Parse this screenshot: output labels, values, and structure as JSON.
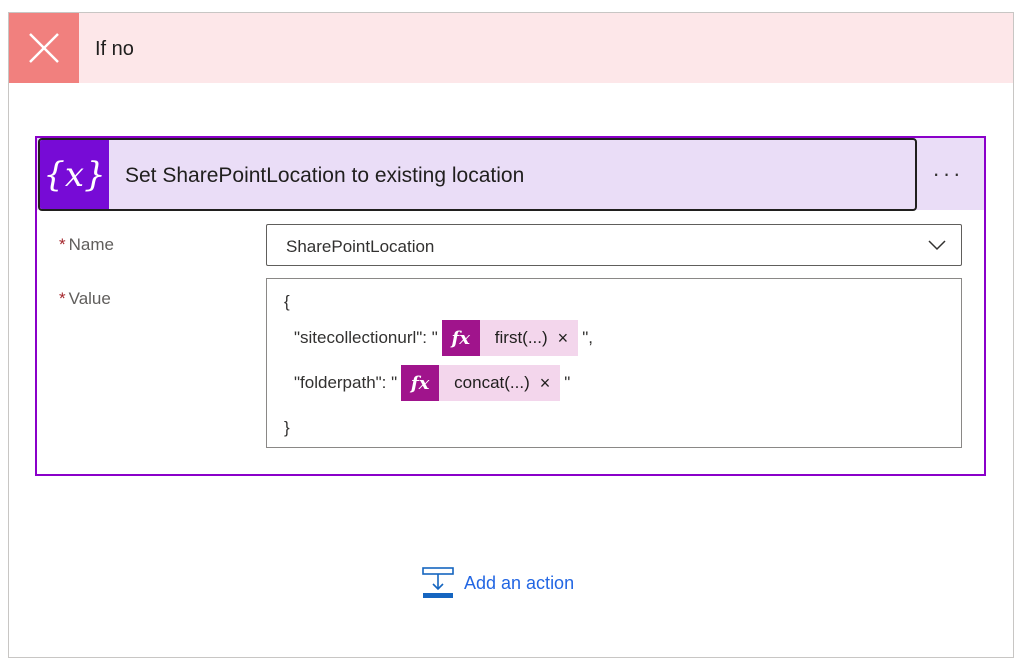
{
  "branch": {
    "title": "If no",
    "header_color": "#fde7e9",
    "icon_bg": "#f1807e",
    "icon": "close-icon"
  },
  "action_card": {
    "title": "Set SharePointLocation to existing location",
    "icon": "variable-icon",
    "icon_glyph": "{x}",
    "more_label": "···",
    "accent": "#8a00c9",
    "fields": {
      "name": {
        "required_mark": "*",
        "label": "Name",
        "value": "SharePointLocation"
      },
      "value": {
        "required_mark": "*",
        "label": "Value",
        "lines": {
          "open": "{",
          "site_key": "\"sitecollectionurl\": \"",
          "site_token": {
            "icon": "fx-icon",
            "glyph": "fx",
            "label": "first(...)",
            "remove": "×"
          },
          "site_suffix": "\",",
          "folder_key": "\"folderpath\": \"",
          "folder_token": {
            "icon": "fx-icon",
            "glyph": "fx",
            "label": "concat(...)",
            "remove": "×"
          },
          "folder_suffix": "\"",
          "close": "}"
        }
      }
    }
  },
  "add_action": {
    "label": "Add an action",
    "icon": "add-action-icon",
    "color": "#2266e3"
  }
}
